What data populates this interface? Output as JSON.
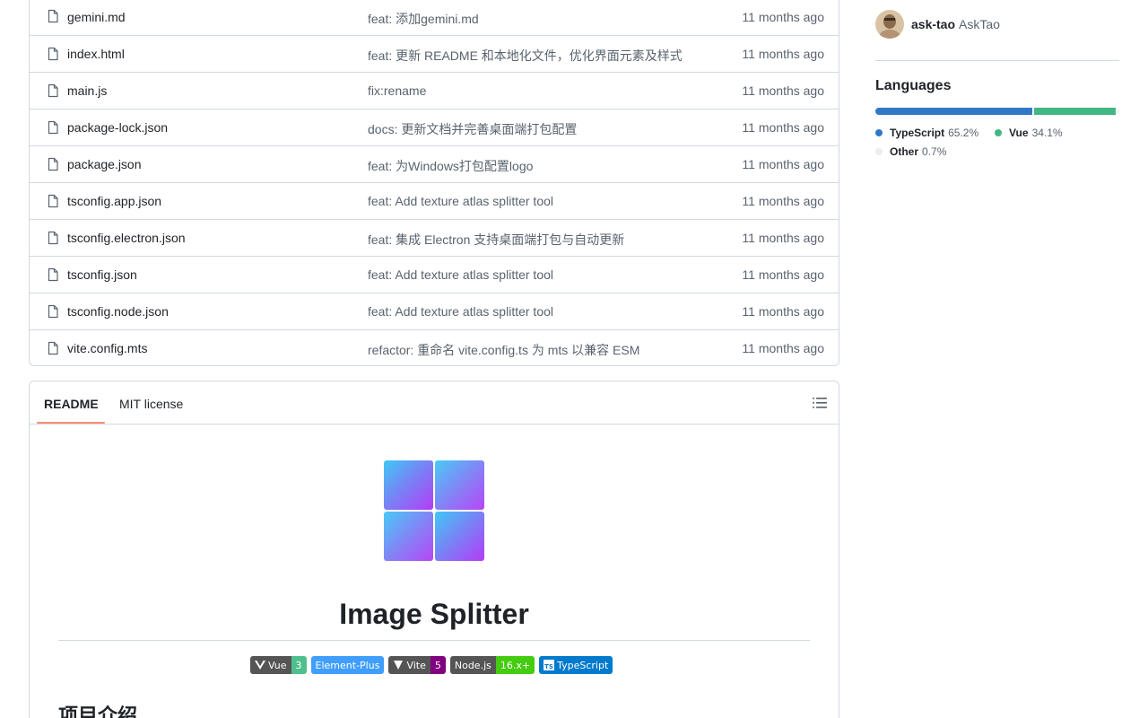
{
  "files": [
    {
      "name": "gemini.md",
      "message": "feat: 添加gemini.md",
      "time": "11 months ago"
    },
    {
      "name": "index.html",
      "message": "feat: 更新 README 和本地化文件，优化界面元素及样式",
      "time": "11 months ago"
    },
    {
      "name": "main.js",
      "message": "fix:rename",
      "time": "11 months ago"
    },
    {
      "name": "package-lock.json",
      "message": "docs: 更新文档并完善桌面端打包配置",
      "time": "11 months ago"
    },
    {
      "name": "package.json",
      "message": "feat: 为Windows打包配置logo",
      "time": "11 months ago"
    },
    {
      "name": "tsconfig.app.json",
      "message": "feat: Add texture atlas splitter tool",
      "time": "11 months ago"
    },
    {
      "name": "tsconfig.electron.json",
      "message": "feat: 集成 Electron 支持桌面端打包与自动更新",
      "time": "11 months ago"
    },
    {
      "name": "tsconfig.json",
      "message": "feat: Add texture atlas splitter tool",
      "time": "11 months ago"
    },
    {
      "name": "tsconfig.node.json",
      "message": "feat: Add texture atlas splitter tool",
      "time": "11 months ago"
    },
    {
      "name": "vite.config.mts",
      "message": "refactor: 重命名 vite.config.ts 为 mts 以兼容 ESM",
      "time": "11 months ago"
    }
  ],
  "readme": {
    "tabs": {
      "readme": "README",
      "license": "MIT license"
    },
    "title": "Image Splitter",
    "badges": [
      {
        "label": "Vue",
        "value": "3",
        "color": "#4fc08d",
        "icon": "vue-icon"
      },
      {
        "label": "",
        "value": "Element-Plus",
        "color": "#409eff",
        "icon": ""
      },
      {
        "label": "Vite",
        "value": "5",
        "color": "#800080",
        "icon": "vite-icon"
      },
      {
        "label": "Node.js",
        "value": "16.x+",
        "color": "#4c1",
        "icon": ""
      },
      {
        "label": "",
        "value": "TypeScript",
        "color": "#007acc",
        "icon": "typescript-icon"
      }
    ],
    "section_heading": "项目介绍"
  },
  "sidebar": {
    "contributor": {
      "login": "ask-tao",
      "name": "AskTao"
    },
    "languages_title": "Languages",
    "languages": [
      {
        "name": "TypeScript",
        "percent": "65.2%",
        "share": 65.2,
        "color": "#3178c6"
      },
      {
        "name": "Vue",
        "percent": "34.1%",
        "share": 34.1,
        "color": "#41b883"
      },
      {
        "name": "Other",
        "percent": "0.7%",
        "share": 0.7,
        "color": "#ededed"
      }
    ]
  }
}
